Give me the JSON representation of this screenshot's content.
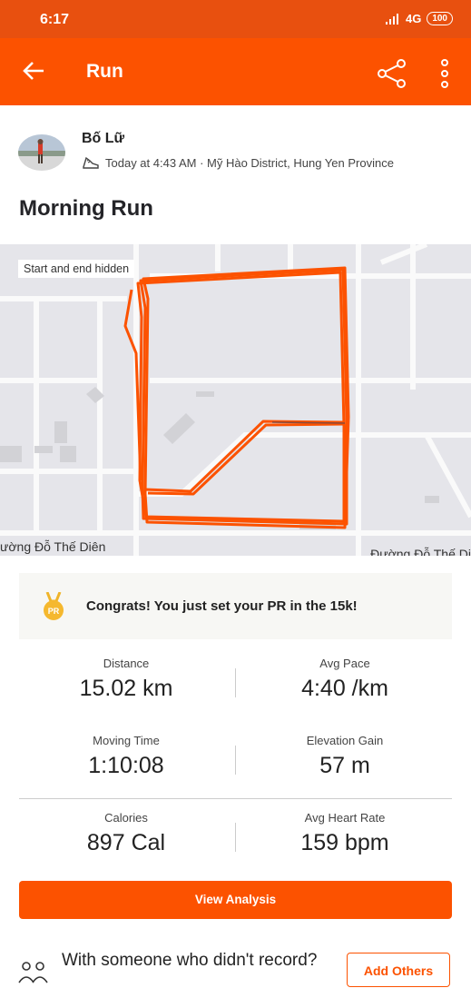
{
  "status_bar": {
    "time": "6:17",
    "network": "4G",
    "battery": "100"
  },
  "app_bar": {
    "title": "Run"
  },
  "athlete": {
    "name": "Bố Lữ",
    "meta": "Today at 4:43 AM · Mỹ Hào District, Hung Yen Province"
  },
  "activity": {
    "title": "Morning Run"
  },
  "map": {
    "badge": "Start and end hidden",
    "street_left": "ường Đỗ Thế Diên",
    "street_right": "Đường Đỗ Thế Di",
    "route_color": "#fc5200"
  },
  "achievement": {
    "text": "Congrats! You just set your PR in the 15k!",
    "medal_label": "PR"
  },
  "stats": {
    "distance": {
      "label": "Distance",
      "value": "15.02 km"
    },
    "avg_pace": {
      "label": "Avg Pace",
      "value": "4:40 /km"
    },
    "moving_time": {
      "label": "Moving Time",
      "value": "1:10:08"
    },
    "elevation_gain": {
      "label": "Elevation Gain",
      "value": "57 m"
    },
    "calories": {
      "label": "Calories",
      "value": "897 Cal"
    },
    "avg_heart_rate": {
      "label": "Avg Heart Rate",
      "value": "159 bpm"
    }
  },
  "buttons": {
    "view_analysis": "View Analysis",
    "add_others": "Add Others"
  },
  "with_others": {
    "text": "With someone who didn't record?"
  },
  "colors": {
    "brand": "#fc5200",
    "status_bar": "#e8500f"
  }
}
